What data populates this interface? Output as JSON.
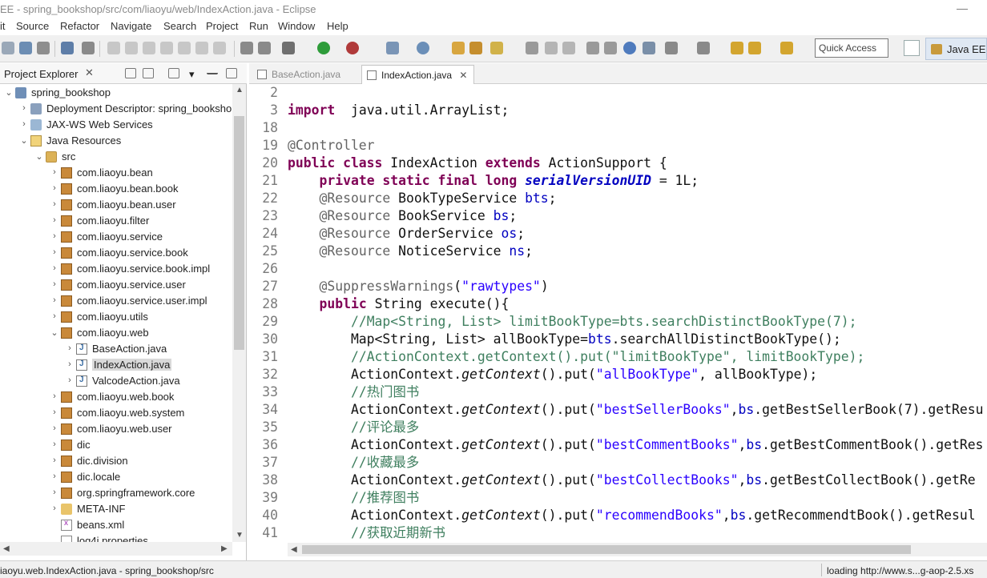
{
  "window": {
    "title": "EE - spring_bookshop/src/com/liaoyu/web/IndexAction.java - Eclipse"
  },
  "menu": [
    "it",
    "Source",
    "Refactor",
    "Navigate",
    "Search",
    "Project",
    "Run",
    "Window",
    "Help"
  ],
  "toolbar": {
    "quick_access": "Quick Access",
    "perspective": "Java EE"
  },
  "explorer": {
    "title": "Project Explorer",
    "close": "✕",
    "items": [
      {
        "label": "spring_bookshop",
        "icon": "project-icon"
      },
      {
        "label": "Deployment Descriptor: spring_bookshop",
        "icon": "deployment-descriptor-icon"
      },
      {
        "label": "JAX-WS Web Services",
        "icon": "web-services-icon"
      },
      {
        "label": "Java Resources",
        "icon": "java-resources-icon"
      },
      {
        "label": "src",
        "icon": "source-folder-icon"
      },
      {
        "label": "com.liaoyu.bean",
        "icon": "package-icon"
      },
      {
        "label": "com.liaoyu.bean.book",
        "icon": "package-icon"
      },
      {
        "label": "com.liaoyu.bean.user",
        "icon": "package-icon"
      },
      {
        "label": "com.liaoyu.filter",
        "icon": "package-icon"
      },
      {
        "label": "com.liaoyu.service",
        "icon": "package-icon"
      },
      {
        "label": "com.liaoyu.service.book",
        "icon": "package-icon"
      },
      {
        "label": "com.liaoyu.service.book.impl",
        "icon": "package-icon"
      },
      {
        "label": "com.liaoyu.service.user",
        "icon": "package-icon"
      },
      {
        "label": "com.liaoyu.service.user.impl",
        "icon": "package-icon"
      },
      {
        "label": "com.liaoyu.utils",
        "icon": "package-icon"
      },
      {
        "label": "com.liaoyu.web",
        "icon": "package-icon"
      },
      {
        "label": "BaseAction.java",
        "icon": "java-file-icon"
      },
      {
        "label": "IndexAction.java",
        "icon": "java-file-icon"
      },
      {
        "label": "ValcodeAction.java",
        "icon": "java-file-icon"
      },
      {
        "label": "com.liaoyu.web.book",
        "icon": "package-icon"
      },
      {
        "label": "com.liaoyu.web.system",
        "icon": "package-icon"
      },
      {
        "label": "com.liaoyu.web.user",
        "icon": "package-icon"
      },
      {
        "label": "dic",
        "icon": "package-icon"
      },
      {
        "label": "dic.division",
        "icon": "package-icon"
      },
      {
        "label": "dic.locale",
        "icon": "package-icon"
      },
      {
        "label": "org.springframework.core",
        "icon": "package-icon"
      },
      {
        "label": "META-INF",
        "icon": "folder-icon"
      },
      {
        "label": "beans.xml",
        "icon": "xml-file-icon"
      },
      {
        "label": "log4j.properties",
        "icon": "file-icon"
      }
    ]
  },
  "editor": {
    "tabs": [
      {
        "label": "BaseAction.java",
        "active": false
      },
      {
        "label": "IndexAction.java",
        "active": true,
        "close": "✕"
      }
    ],
    "lines": [
      {
        "n": "2",
        "tokens": []
      },
      {
        "n": "3",
        "tokens": [
          [
            "kw",
            "import"
          ],
          [
            "",
            "  java.util.ArrayList;"
          ]
        ]
      },
      {
        "n": "18",
        "tokens": []
      },
      {
        "n": "19",
        "tokens": [
          [
            "an",
            "@Controller"
          ]
        ]
      },
      {
        "n": "20",
        "tokens": [
          [
            "kw",
            "public class"
          ],
          [
            "",
            " IndexAction "
          ],
          [
            "kw",
            "extends"
          ],
          [
            "",
            " ActionSupport {"
          ]
        ]
      },
      {
        "n": "21",
        "tokens": [
          [
            "",
            "    "
          ],
          [
            "kw",
            "private static final long"
          ],
          [
            "",
            " "
          ],
          [
            "sfld",
            "serialVersionUID"
          ],
          [
            "",
            " = 1L;"
          ]
        ]
      },
      {
        "n": "22",
        "tokens": [
          [
            "",
            "    "
          ],
          [
            "an",
            "@Resource"
          ],
          [
            "",
            " BookTypeService "
          ],
          [
            "fld",
            "bts"
          ],
          [
            "",
            ";"
          ]
        ]
      },
      {
        "n": "23",
        "tokens": [
          [
            "",
            "    "
          ],
          [
            "an",
            "@Resource"
          ],
          [
            "",
            " BookService "
          ],
          [
            "fld",
            "bs"
          ],
          [
            "",
            ";"
          ]
        ]
      },
      {
        "n": "24",
        "tokens": [
          [
            "",
            "    "
          ],
          [
            "an",
            "@Resource"
          ],
          [
            "",
            " OrderService "
          ],
          [
            "fld",
            "os"
          ],
          [
            "",
            ";"
          ]
        ]
      },
      {
        "n": "25",
        "tokens": [
          [
            "",
            "    "
          ],
          [
            "an",
            "@Resource"
          ],
          [
            "",
            " NoticeService "
          ],
          [
            "fld",
            "ns"
          ],
          [
            "",
            ";"
          ]
        ]
      },
      {
        "n": "26",
        "tokens": []
      },
      {
        "n": "27",
        "tokens": [
          [
            "",
            "    "
          ],
          [
            "an",
            "@SuppressWarnings"
          ],
          [
            "",
            "("
          ],
          [
            "str",
            "\"rawtypes\""
          ],
          [
            "",
            ")"
          ]
        ]
      },
      {
        "n": "28",
        "tokens": [
          [
            "",
            "    "
          ],
          [
            "kw",
            "public"
          ],
          [
            "",
            " String execute(){"
          ]
        ]
      },
      {
        "n": "29",
        "tokens": [
          [
            "",
            "        "
          ],
          [
            "cm",
            "//Map<String, List> limitBookType=bts.searchDistinctBookType(7);"
          ]
        ]
      },
      {
        "n": "30",
        "tokens": [
          [
            "",
            "        Map<String, List> allBookType="
          ],
          [
            "fld",
            "bts"
          ],
          [
            "",
            ".searchAllDistinctBookType();"
          ]
        ]
      },
      {
        "n": "31",
        "tokens": [
          [
            "",
            "        "
          ],
          [
            "cm",
            "//ActionContext.getContext().put(\"limitBookType\", limitBookType);"
          ]
        ]
      },
      {
        "n": "32",
        "tokens": [
          [
            "",
            "        ActionContext."
          ],
          [
            "it",
            "getContext"
          ],
          [
            "",
            "().put("
          ],
          [
            "str",
            "\"allBookType\""
          ],
          [
            "",
            ", allBookType);"
          ]
        ]
      },
      {
        "n": "33",
        "tokens": [
          [
            "",
            "        "
          ],
          [
            "cm",
            "//热门图书"
          ]
        ]
      },
      {
        "n": "34",
        "tokens": [
          [
            "",
            "        ActionContext."
          ],
          [
            "it",
            "getContext"
          ],
          [
            "",
            "().put("
          ],
          [
            "str",
            "\"bestSellerBooks\""
          ],
          [
            "",
            ","
          ],
          [
            "fld",
            "bs"
          ],
          [
            "",
            ".getBestSellerBook(7).getResu"
          ]
        ]
      },
      {
        "n": "35",
        "tokens": [
          [
            "",
            "        "
          ],
          [
            "cm",
            "//评论最多"
          ]
        ]
      },
      {
        "n": "36",
        "tokens": [
          [
            "",
            "        ActionContext."
          ],
          [
            "it",
            "getContext"
          ],
          [
            "",
            "().put("
          ],
          [
            "str",
            "\"bestCommentBooks\""
          ],
          [
            "",
            ","
          ],
          [
            "fld",
            "bs"
          ],
          [
            "",
            ".getBestCommentBook().getRes"
          ]
        ]
      },
      {
        "n": "37",
        "tokens": [
          [
            "",
            "        "
          ],
          [
            "cm",
            "//收藏最多"
          ]
        ]
      },
      {
        "n": "38",
        "tokens": [
          [
            "",
            "        ActionContext."
          ],
          [
            "it",
            "getContext"
          ],
          [
            "",
            "().put("
          ],
          [
            "str",
            "\"bestCollectBooks\""
          ],
          [
            "",
            ","
          ],
          [
            "fld",
            "bs"
          ],
          [
            "",
            ".getBestCollectBook().getRe"
          ]
        ]
      },
      {
        "n": "39",
        "tokens": [
          [
            "",
            "        "
          ],
          [
            "cm",
            "//推荐图书"
          ]
        ]
      },
      {
        "n": "40",
        "tokens": [
          [
            "",
            "        ActionContext."
          ],
          [
            "it",
            "getContext"
          ],
          [
            "",
            "().put("
          ],
          [
            "str",
            "\"recommendBooks\""
          ],
          [
            "",
            ","
          ],
          [
            "fld",
            "bs"
          ],
          [
            "",
            ".getRecommendtBook().getResul"
          ]
        ]
      },
      {
        "n": "41",
        "tokens": [
          [
            "",
            "        "
          ],
          [
            "cm",
            "//获取近期新书"
          ]
        ]
      }
    ]
  },
  "status": {
    "left": "iaoyu.web.IndexAction.java - spring_bookshop/src",
    "right": "loading http://www.s...g-aop-2.5.xs"
  }
}
